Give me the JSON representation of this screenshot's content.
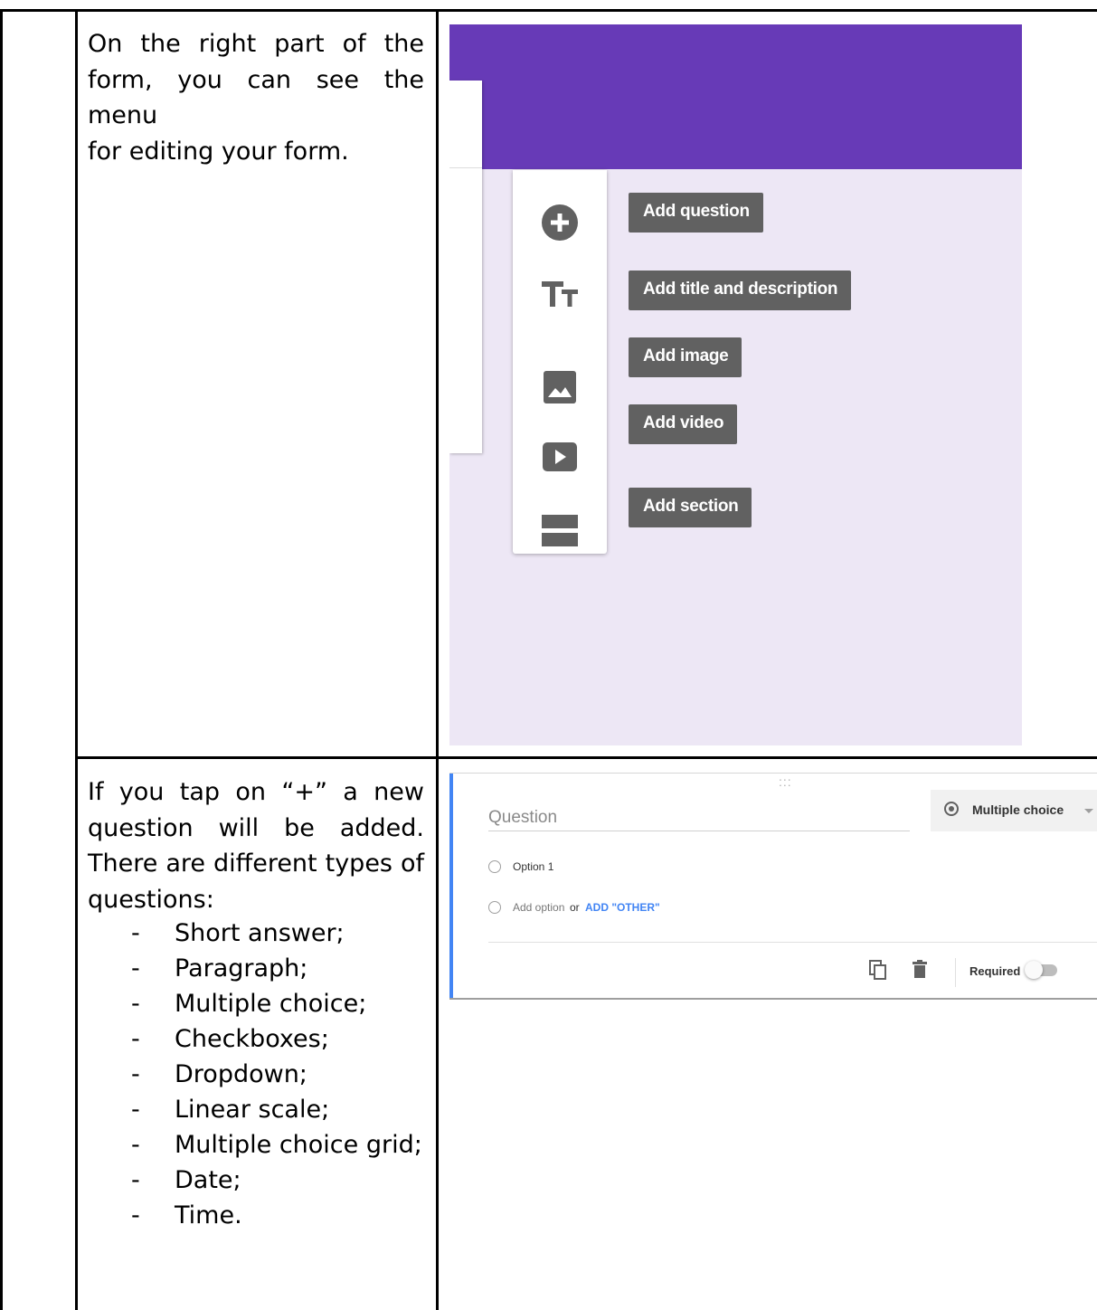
{
  "row1": {
    "description": "On the right part of the form, you can see the menu for editing your form.",
    "lines": [
      "On the right part of the",
      "form, you can see the menu",
      "for editing your form."
    ],
    "toolbar": [
      {
        "icon": "add-circle-icon",
        "label": "Add question"
      },
      {
        "icon": "title-text-icon",
        "label": "Add title and description"
      },
      {
        "icon": "image-icon",
        "label": "Add image"
      },
      {
        "icon": "video-icon",
        "label": "Add video"
      },
      {
        "icon": "section-icon",
        "label": "Add section"
      }
    ],
    "colors": {
      "header": "#673ab7",
      "background": "#ede7f5",
      "tooltip": "#616161"
    }
  },
  "row2": {
    "lines": [
      "If you tap on “+” a new",
      "question will be added.",
      "There are different types of",
      "questions:"
    ],
    "question_types": [
      "Short answer;",
      "Paragraph;",
      "Multiple choice;",
      "Checkboxes;",
      "Dropdown;",
      "Linear scale;",
      "Multiple choice grid;",
      "Date;",
      "Time."
    ],
    "editor": {
      "drag_handle": ":::",
      "question_placeholder": "Question",
      "type_selected": "Multiple choice",
      "option1": "Option 1",
      "add_option": "Add option",
      "or": "or",
      "add_other": "ADD \"OTHER\"",
      "required_label": "Required",
      "accent_color": "#4285f4"
    }
  }
}
